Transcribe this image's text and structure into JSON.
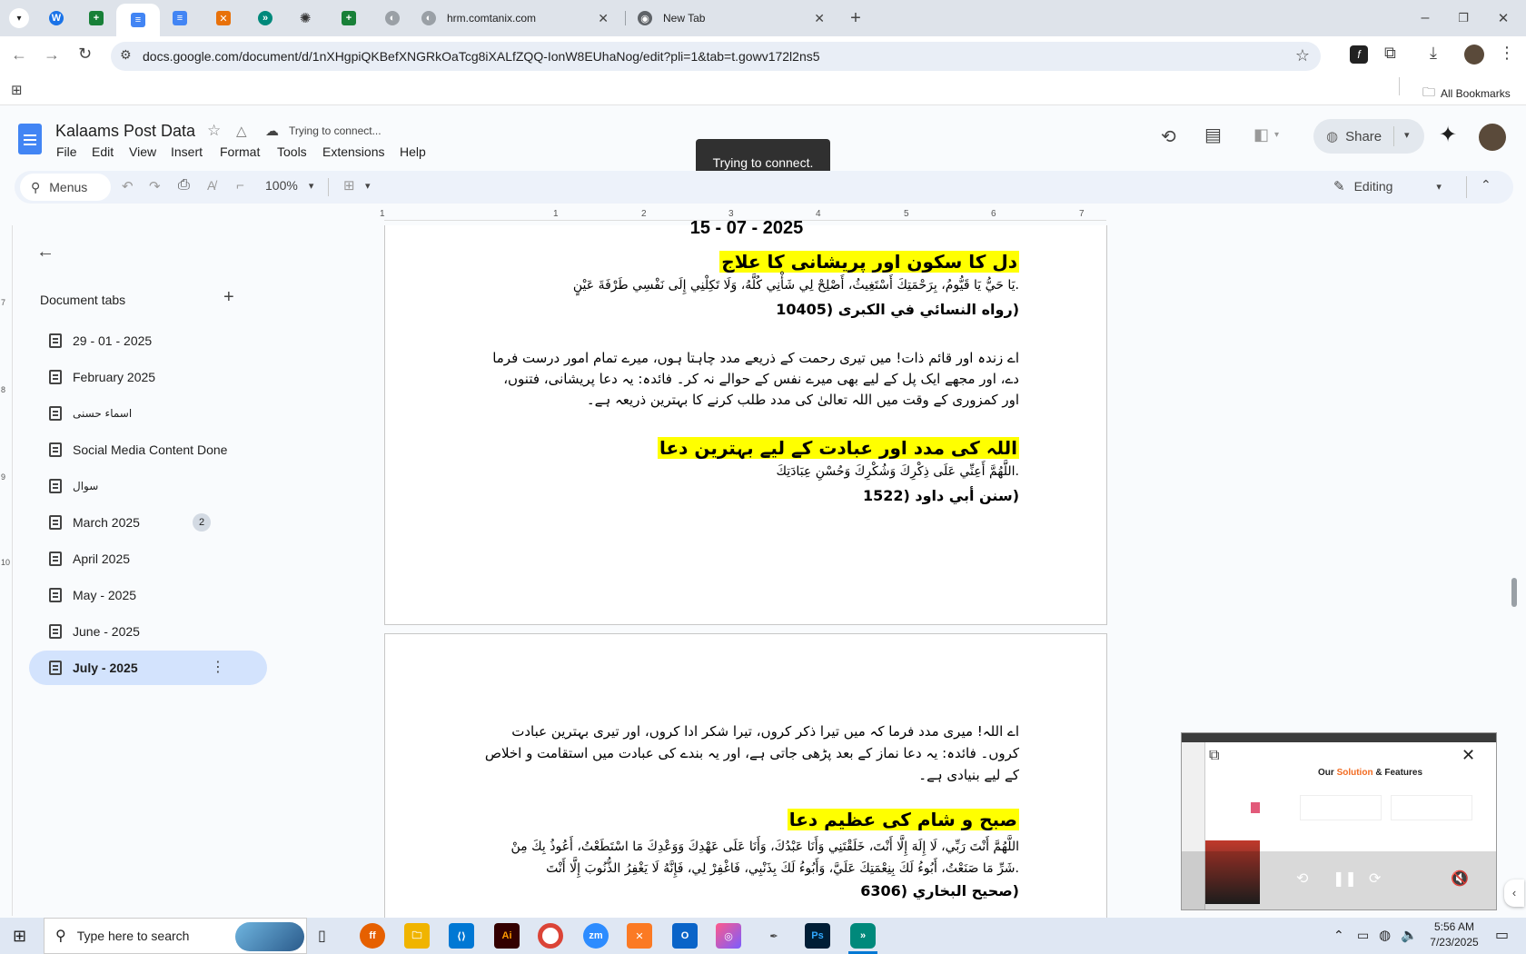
{
  "browser": {
    "tabs": [
      {
        "label": "hrm.comtanix.com"
      },
      {
        "label": "New Tab"
      }
    ],
    "url": "docs.google.com/document/d/1nXHgpiQKBefXNGRkOaTcg8iXALfZQQ-IonW8EUhaNog/edit?pli=1&tab=t.gowv172l2ns5",
    "bookmarks_label": "All Bookmarks"
  },
  "doc": {
    "title": "Kalaams Post Data",
    "status": "Trying to connect...",
    "menus": [
      "File",
      "Edit",
      "View",
      "Insert",
      "Format",
      "Tools",
      "Extensions",
      "Help"
    ],
    "share_label": "Share",
    "toast": "Trying to connect."
  },
  "toolbar": {
    "search_label": "Menus",
    "zoom": "100%",
    "mode": "Editing"
  },
  "ruler": {
    "labels": [
      "1",
      "1",
      "2",
      "3",
      "4",
      "5",
      "6",
      "7"
    ],
    "vertical": [
      "7",
      "8",
      "9",
      "10"
    ]
  },
  "sidebar": {
    "heading": "Document tabs",
    "items": [
      {
        "label": "29 - 01 - 2025"
      },
      {
        "label": "February 2025"
      },
      {
        "label": "اسماء حسنی"
      },
      {
        "label": "Social Media Content Done"
      },
      {
        "label": "سوال"
      },
      {
        "label": "March 2025",
        "badge": "2"
      },
      {
        "label": "April 2025"
      },
      {
        "label": "May - 2025"
      },
      {
        "label": "June - 2025"
      },
      {
        "label": "July - 2025"
      }
    ]
  },
  "content": {
    "date_partial": "15 - 07 - 2025",
    "h1": "دل کا سکون اور پریشانی کا علاج",
    "a1": ".يَا حَيُّ يَا قَيُّومُ، بِرَحْمَتِكَ أَسْتَغِيثُ، أَصْلِحْ لِي شَأْنِي كُلَّهُ، وَلَا تَكِلْنِي إِلَى نَفْسِي طَرْفَةَ عَيْنٍ",
    "r1": "(رواه النسائي في الكبرى (10405",
    "u1": [
      "اے زندہ اور قائم ذات! میں تیری رحمت کے ذریعے مدد چاہتا ہوں، میرے تمام امور درست فرما",
      "دے، اور مجھے ایک پل کے لیے بھی میرے نفس کے حوالے نہ کر۔ فائدہ: یہ دعا پریشانی، فتنوں،",
      "اور کمزوری کے وقت میں اللہ تعالیٰ کی مدد طلب کرنے کا بہترین ذریعہ ہے۔"
    ],
    "h2": "اللہ کی مدد اور عبادت کے لیے بہترین دعا",
    "a2": ".اللَّهُمَّ أَعِنِّي عَلَى ذِكْرِكَ وَشُكْرِكَ وَحُسْنِ عِبَادَتِكَ",
    "r2": "(سنن أبي داود (1522",
    "u2": [
      "اے اللہ! میری مدد فرما کہ میں تیرا ذکر کروں، تیرا شکر ادا کروں، اور تیری بہترین عبادت",
      "کروں۔ فائدہ: یہ دعا نماز کے بعد پڑھی جاتی ہے، اور یہ بندے کی عبادت میں استقامت و اخلاص",
      "کے لیے بنیادی ہے۔"
    ],
    "h3": "صبح و شام کی عظیم دعا",
    "a3": [
      "اللَّهُمَّ أَنْتَ رَبِّي، لَا إِلَهَ إِلَّا أَنْتَ، خَلَقْتَنِي وَأَنَا عَبْدُكَ، وَأَنَا عَلَى عَهْدِكَ وَوَعْدِكَ مَا اسْتَطَعْتُ، أَعُوذُ بِكَ مِنْ",
      ".شَرِّ مَا صَنَعْتُ، أَبُوءُ لَكَ بِنِعْمَتِكَ عَلَيَّ، وَأَبُوءُ لَكَ بِذَنْبِي، فَاغْفِرْ لِي، فَإِنَّهُ لَا يَغْفِرُ الذُّنُوبَ إِلَّا أَنْتَ"
    ],
    "r3": "(صحيح البخاري (6306"
  },
  "pip": {
    "heading_part1": "Our ",
    "heading_part2": "Solution",
    "heading_part3": " & Features"
  },
  "taskbar": {
    "search_placeholder": "Type here to search",
    "time": "5:56 AM",
    "date": "7/23/2025"
  },
  "colors": {
    "docs_blue": "#1a73e8",
    "selected_tab_bg": "#d3e3fd",
    "highlight": "#ffff00",
    "tabstrip_bg": "#dee3ea"
  }
}
